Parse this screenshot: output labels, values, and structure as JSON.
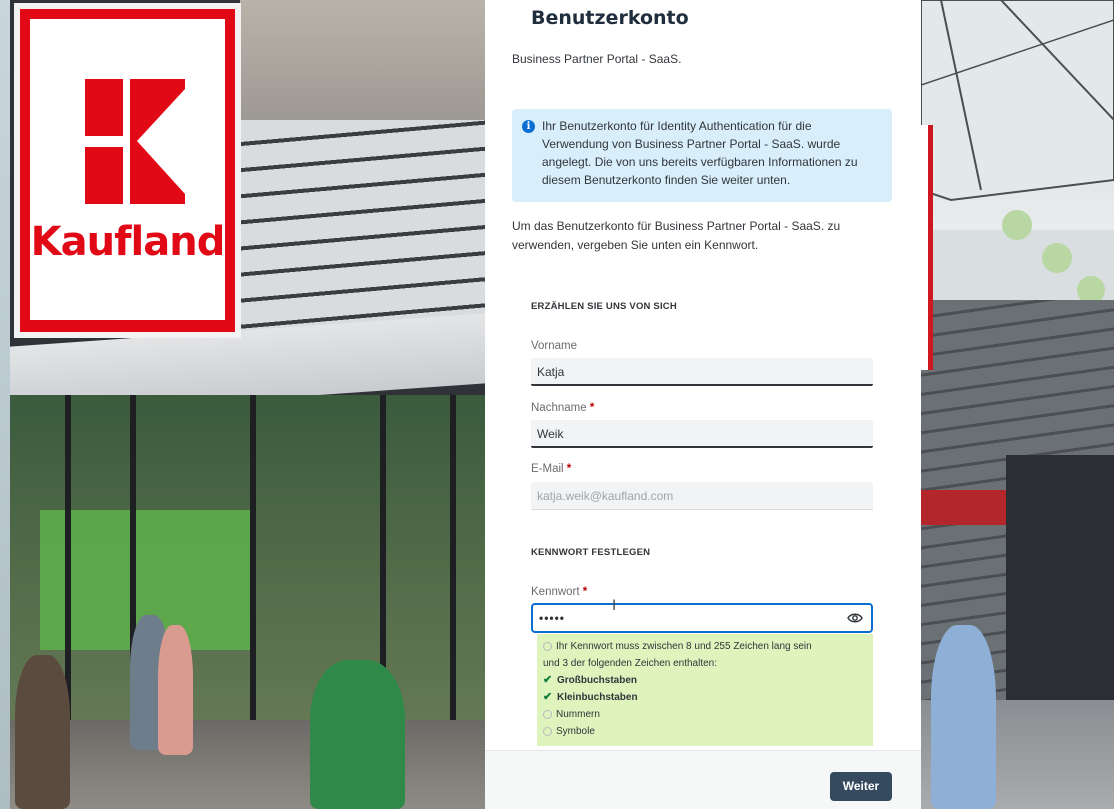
{
  "background": {
    "brand": "Kaufland",
    "colors": {
      "brand_red": "#e10915",
      "panel": "#ffffff",
      "primary_button": "#354a5f",
      "focus": "#0a6ed1",
      "hint_bg": "#dff3bd",
      "info_bg": "#d8eefb"
    }
  },
  "form": {
    "title": "Benutzerkonto",
    "subtitle": "Business Partner Portal - SaaS.",
    "info_icon": "info-icon",
    "info_message": "Ihr Benutzerkonto für Identity Authentication für die Verwendung von Business Partner Portal - SaaS. wurde angelegt. Die von uns bereits verfügbaren Informationen zu diesem Benutzerkonto finden Sie weiter unten.",
    "intro": "Um das Benutzerkonto für Business Partner Portal - SaaS. zu verwenden, vergeben Sie unten ein Kennwort.",
    "section_about": "ERZÄHLEN SIE UNS VON SICH",
    "first_name": {
      "label": "Vorname",
      "value": "Katja"
    },
    "last_name": {
      "label": "Nachname",
      "required": "*",
      "value": "Weik"
    },
    "email": {
      "label": "E-Mail",
      "required": "*",
      "value": "katja.weik@kaufland.com"
    },
    "section_password": "KENNWORT FESTLEGEN",
    "password": {
      "label": "Kennwort",
      "required": "*",
      "value": "•••••",
      "toggle_icon": "eye-icon"
    },
    "password_rules": {
      "intro_line1": "Ihr Kennwort muss zwischen 8 und 255 Zeichen lang sein",
      "intro_line2": "und 3 der folgenden Zeichen enthalten:",
      "items": [
        {
          "label": "Großbuchstaben",
          "met": true
        },
        {
          "label": "Kleinbuchstaben",
          "met": true
        },
        {
          "label": "Nummern",
          "met": false
        },
        {
          "label": "Symbole",
          "met": false
        }
      ]
    },
    "continue_button": "Weiter"
  }
}
